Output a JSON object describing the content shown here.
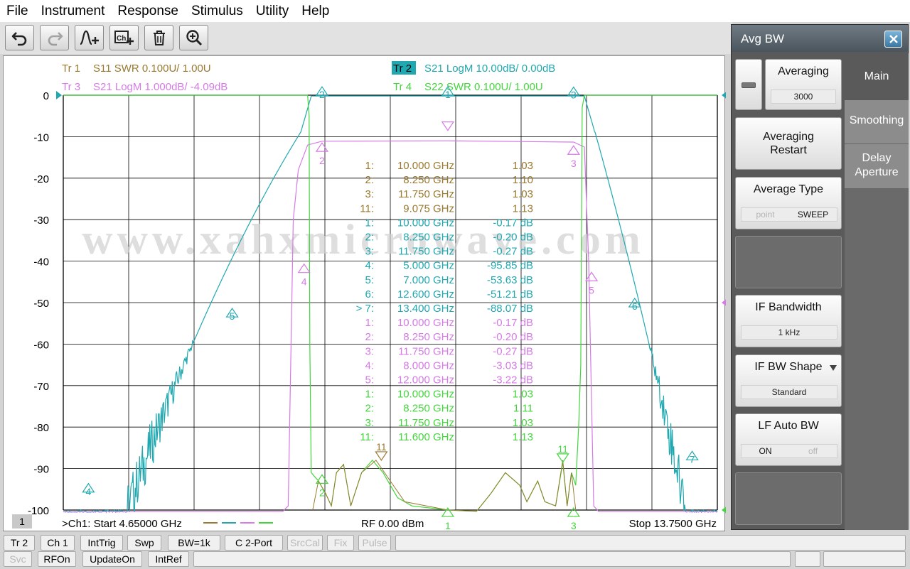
{
  "menu": [
    "File",
    "Instrument",
    "Response",
    "Stimulus",
    "Utility",
    "Help"
  ],
  "toolbar": [
    {
      "name": "undo-icon",
      "disabled": false
    },
    {
      "name": "redo-icon",
      "disabled": true
    },
    {
      "name": "add-marker-icon",
      "disabled": false
    },
    {
      "name": "add-channel-icon",
      "disabled": false
    },
    {
      "name": "trash-icon",
      "disabled": false
    },
    {
      "name": "zoom-icon",
      "disabled": false
    }
  ],
  "traces": [
    {
      "id": "Tr 1",
      "desc": "S11 SWR 0.100U/  1.00U",
      "color": "#9a7a30",
      "active": false
    },
    {
      "id": "Tr 2",
      "desc": "S21 LogM 10.00dB/  0.00dB",
      "color": "#1fa8b0",
      "active": true
    },
    {
      "id": "Tr 3",
      "desc": "S21 LogM 1.000dB/  -4.09dB",
      "color": "#d57ae6",
      "active": false
    },
    {
      "id": "Tr 4",
      "desc": "S22 SWR 0.100U/  1.00U",
      "color": "#43d63c",
      "active": false
    }
  ],
  "chart_data": {
    "type": "line",
    "x_range_ghz": [
      4.65,
      13.75
    ],
    "ylim": [
      -100,
      0
    ],
    "y_ticks": [
      "0",
      "-10",
      "-20",
      "-30",
      "-40",
      "-50",
      "-60",
      "-70",
      "-80",
      "-90",
      "-100"
    ],
    "grid": true,
    "watermark": "www.xahxmicrowave.com",
    "markers": [
      {
        "id": "1",
        "x_ghz": 10.0,
        "y": -0.17,
        "trace": "Tr 2"
      },
      {
        "id": "2",
        "x_ghz": 8.25,
        "y": -0.2,
        "trace": "Tr 2"
      },
      {
        "id": "3",
        "x_ghz": 11.75,
        "y": -0.27,
        "trace": "Tr 2"
      },
      {
        "id": "4",
        "x_ghz": 5.0,
        "y": -95.85,
        "trace": "Tr 2"
      },
      {
        "id": "5",
        "x_ghz": 7.0,
        "y": -53.63,
        "trace": "Tr 2"
      },
      {
        "id": "6",
        "x_ghz": 12.6,
        "y": -51.21,
        "trace": "Tr 2"
      },
      {
        "id": "7",
        "x_ghz": 13.4,
        "y": -88.07,
        "trace": "Tr 2"
      },
      {
        "id": "4",
        "x_ghz": 8.0,
        "y": -40.7,
        "trace": "Tr 3"
      },
      {
        "id": "5",
        "x_ghz": 12.0,
        "y": -42.7,
        "trace": "Tr 3"
      }
    ],
    "marker_table": [
      {
        "color": "#9a7a30",
        "rows": [
          [
            "1:",
            "10.000  GHz",
            "1.03"
          ],
          [
            "2:",
            "8.250  GHz",
            "1.10"
          ],
          [
            "3:",
            "11.750  GHz",
            "1.03"
          ],
          [
            "11:",
            "9.075  GHz",
            "1.13"
          ]
        ]
      },
      {
        "color": "#1fa8b0",
        "rows": [
          [
            "1:",
            "10.000  GHz",
            "-0.17 dB"
          ],
          [
            "2:",
            "8.250  GHz",
            "-0.20 dB"
          ],
          [
            "3:",
            "11.750  GHz",
            "-0.27 dB"
          ],
          [
            "4:",
            "5.000  GHz",
            "-95.85 dB"
          ],
          [
            "5:",
            "7.000  GHz",
            "-53.63 dB"
          ],
          [
            "6:",
            "12.600  GHz",
            "-51.21 dB"
          ],
          [
            "> 7:",
            "13.400  GHz",
            "-88.07 dB"
          ]
        ]
      },
      {
        "color": "#d57ae6",
        "rows": [
          [
            "1:",
            "10.000  GHz",
            "-0.17 dB"
          ],
          [
            "2:",
            "8.250  GHz",
            "-0.20 dB"
          ],
          [
            "3:",
            "11.750  GHz",
            "-0.27 dB"
          ],
          [
            "4:",
            "8.000  GHz",
            "-3.03 dB"
          ],
          [
            "5:",
            "12.000  GHz",
            "-3.22 dB"
          ]
        ]
      },
      {
        "color": "#43d63c",
        "rows": [
          [
            "1:",
            "10.000  GHz",
            "1.03"
          ],
          [
            "2:",
            "8.250  GHz",
            "1.11"
          ],
          [
            "3:",
            "11.750  GHz",
            "1.03"
          ],
          [
            "11:",
            "11.600  GHz",
            "1.13"
          ]
        ]
      }
    ]
  },
  "footer": {
    "channel_box": "1",
    "start": ">Ch1:  Start  4.65000 GHz",
    "power": "RF    0.00 dBm",
    "stop": "Stop  13.7500 GHz"
  },
  "panel": {
    "title": "Avg BW",
    "averaging_label": "Averaging",
    "averaging_value": "3000",
    "restart_label": "Averaging Restart",
    "avg_type_label": "Average Type",
    "avg_type_options": [
      "point",
      "SWEEP"
    ],
    "if_bw_label": "IF Bandwidth",
    "if_bw_value": "1 kHz",
    "if_shape_label": "IF BW Shape",
    "if_shape_value": "Standard",
    "lf_auto_label": "LF Auto BW",
    "lf_auto_options": [
      "ON",
      "off"
    ],
    "tabs": [
      "Main",
      "Smoothing",
      "Delay Aperture"
    ]
  },
  "statusbar": {
    "row1": [
      "Tr 2",
      "Ch 1",
      "IntTrig",
      "Swp",
      "BW=1k",
      "C  2-Port",
      "SrcCal",
      "Fix",
      "Pulse"
    ],
    "row2": [
      "Svc",
      "RFOn",
      "UpdateOn",
      "IntRef"
    ]
  },
  "colors": {
    "tr1": "#9a7a30",
    "tr2": "#1fa8b0",
    "tr3": "#d57ae6",
    "tr4": "#43d63c"
  }
}
